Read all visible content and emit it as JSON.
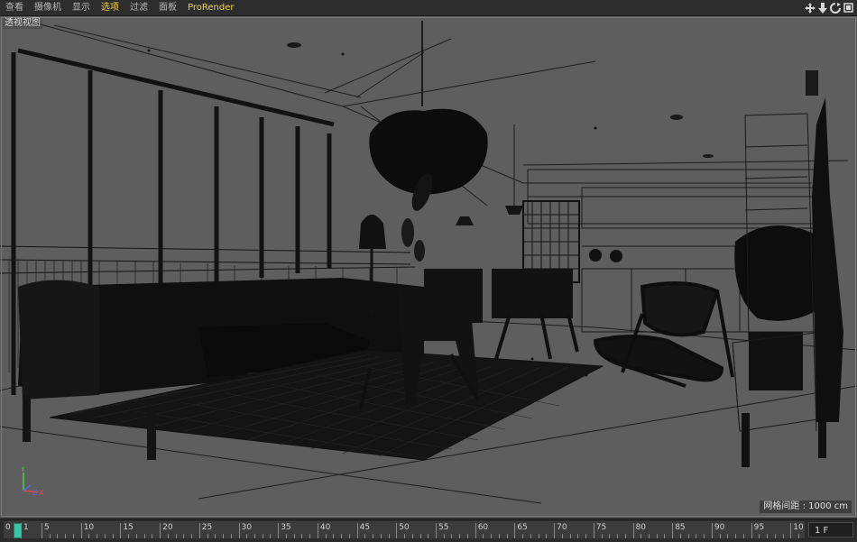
{
  "menubar": {
    "items": [
      {
        "label": "查看",
        "active": false
      },
      {
        "label": "摄像机",
        "active": false
      },
      {
        "label": "显示",
        "active": false
      },
      {
        "label": "选项",
        "active": true
      },
      {
        "label": "过滤",
        "active": false
      },
      {
        "label": "面板",
        "active": false
      },
      {
        "label": "ProRender",
        "active": false
      }
    ],
    "nav_icons": [
      "move-icon",
      "arrow-down-icon",
      "rotate-icon",
      "maximize-icon"
    ]
  },
  "viewport": {
    "camera_label": "透视视图",
    "grid_readout": "网格间距 : 1000 cm",
    "axis": {
      "y": "Y",
      "z": "Z",
      "x": "X"
    }
  },
  "timeline": {
    "start_label": "0",
    "labels": [
      "1",
      "5",
      "10",
      "15",
      "20",
      "25",
      "30",
      "35",
      "40",
      "45",
      "50",
      "55",
      "60",
      "65",
      "70",
      "75",
      "80",
      "85",
      "90",
      "95",
      "10"
    ],
    "current_frame": "1 F",
    "playhead_frame": 1
  },
  "colors": {
    "accent": "#f0d24a",
    "viewport_bg": "#5e5e5e",
    "playhead": "#37c7a7",
    "axis_x": "#e04a4a",
    "axis_y": "#4ad24a",
    "axis_z": "#4a6ae0"
  }
}
